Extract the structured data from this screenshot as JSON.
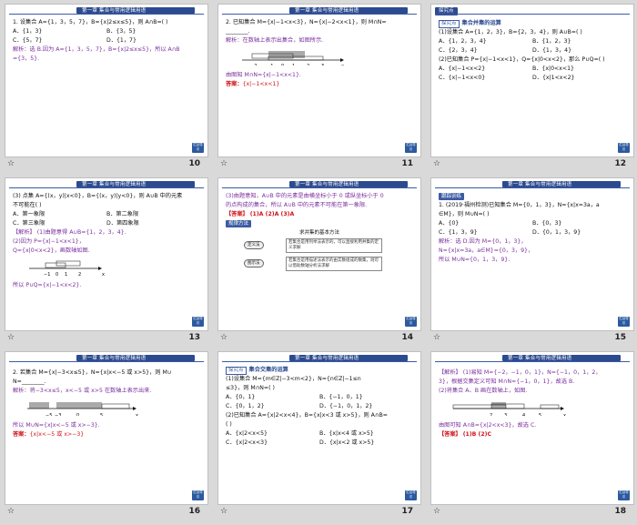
{
  "header_text": "第一章  集合与常用逻辑用语",
  "back_label": "栏目导引",
  "footer_icon": "☆",
  "slides": [
    {
      "num": "10",
      "lines": [
        "1. 设集合 A={1，3，5，7}，B={x|2≤x≤5}，则 A∩B=(      )"
      ],
      "opts": [
        "A．{1，3}",
        "B．{3，5}",
        "C．{5，7}",
        "D．{1，7}"
      ],
      "purple": [
        "解析：选 B.因为 A={1，3，5，7}，B={x|2≤x≤5}，所以 A∩B",
        "={3，5}."
      ]
    },
    {
      "num": "11",
      "lines": [
        "2. 已知集合 M={x|−1<x<3}，N={x|−2<x<1}，则 M∩N=",
        "________."
      ],
      "purple": [
        "解析：在数轴上表示出集合，如图所示."
      ],
      "axis_ticks": [
        "−2",
        "−1",
        "0",
        "1",
        "2",
        "3",
        "x"
      ],
      "purple2": [
        "由图知 M∩N={x|−1<x<1}."
      ],
      "answer_label": "答案：",
      "answer": "{x|−1<x<1}"
    },
    {
      "num": "12",
      "tab": "探究点",
      "tab_title": "集合并集的运算",
      "lines": [
        "(1)设集合 A={1，2，3}，B={2，3，4}，则 A∪B=(      )"
      ],
      "opts": [
        "A．{1，2，3，4}",
        "B．{1，2，3}",
        "C．{2，3，4}",
        "D．{1，3，4}"
      ],
      "lines2": [
        "(2)已知集合 P={x|−1<x<1}，Q={x|0<x<2}，那么 P∪Q=(      )"
      ],
      "opts2": [
        "A．{x|−1<x<2}",
        "B．{x|0<x<1}",
        "C．{x|−1<x<0}",
        "D．{x|1<x<2}"
      ]
    },
    {
      "num": "13",
      "lines": [
        "(3) 点集 A={(x，y)|x<0}，B={(x，y)|y<0}，则 A∪B 中的元素",
        "不可能在(      )"
      ],
      "opts": [
        "A．第一象限",
        "B．第二象限",
        "C．第三象限",
        "D．第四象限"
      ],
      "purple": [
        "【解析】 (1)由题意得 A∪B={1，2，3，4}.",
        "(2)因为 P={x|−1<x<1}，",
        "Q={x|0<x<2}，画数轴如图."
      ],
      "axis_ticks": [
        "−1",
        "0",
        "1",
        "2",
        "x"
      ],
      "purple2": [
        "所以 P∪Q={x|−1<x<2}."
      ]
    },
    {
      "num": "14",
      "purple": [
        "(3)由题意知，A∪B 中的元素是由横坐标小于 0 或纵坐标小于 0",
        "的点构成的集合，所以 A∪B 中的元素不可能在第一象限."
      ],
      "answer_label": "【答案】",
      "answer": "(1)A   (2)A   (3)A",
      "method_tag": "规律方法",
      "diagram_title": "求并集的基本方法",
      "diagram_left": [
        "定义法",
        "图示法"
      ],
      "diagram_right": [
        "若集合是用列举法表示的，可以直接利用并集的定义求解",
        "若集合是用描述法表示的由实数组成的数集，则可以借助数轴分析法求解"
      ]
    },
    {
      "num": "15",
      "tag": "跟踪训练",
      "lines": [
        "1. (2019·福州检测)已知集合 M={0，1，3}，N={x|x=3a，a",
        "∈M}，则 M∪N=(      )"
      ],
      "opts": [
        "A．{0}",
        "B．{0，3}",
        "C．{1，3，9}",
        "D．{0，1，3，9}"
      ],
      "purple": [
        "解析：选 D.因为 M={0，1，3}，",
        "N={x|x=3a，a∈M}={0，3，9}，",
        "所以 M∪N={0，1，3，9}."
      ]
    },
    {
      "num": "16",
      "lines": [
        "2. 若集合 M={x|−3<x≤5}，N={x|x<−5 或 x>5}，则 M∪",
        "N=________."
      ],
      "purple": [
        "解析：将−3<x≤5，x<−5 或 x>5 在数轴上表示出来."
      ],
      "axis_ticks": [
        "−5",
        "−3",
        "0",
        "5",
        "x"
      ],
      "purple2": [
        "所以 M∪N={x|x<−5 或 x>−3}."
      ],
      "answer_label": "答案：",
      "answer": "{x|x<−5 或 x>−3}"
    },
    {
      "num": "17",
      "tab": "探究点",
      "tab_title": "集合交集的运算",
      "lines": [
        "(1)设集合 M={m∈Z|−3<m<2}，N={n∈Z|−1≤n",
        "≤3}，则 M∩N=(      )"
      ],
      "opts": [
        "A．{0，1}",
        "B．{−1，0，1}",
        "C．{0，1，2}",
        "D．{−1，0，1，2}"
      ],
      "lines2": [
        "(2)已知集合 A={x|2<x<4}，B={x|x<3 或 x>5}，则 A∩B=",
        "(      )"
      ],
      "opts2": [
        "A．{x|2<x<5}",
        "B．{x|x<4 或 x>5}",
        "C．{x|2<x<3}",
        "D．{x|x<2 或 x>5}"
      ]
    },
    {
      "num": "18",
      "purple": [
        "【解析】 (1)易知 M={−2，−1，0，1}，N={−1，0，1，2，",
        "3}，根据交集定义可知 M∩N={−1，0，1}，故选 B.",
        "(2)将集合 A、B 画在数轴上，如图."
      ],
      "axis_ticks": [
        "2",
        "3",
        "4",
        "5",
        "x"
      ],
      "purple2": [
        "由图可知 A∩B={x|2<x<3}，故选 C."
      ],
      "answer_label": "【答案】",
      "answer": "(1)B   (2)C"
    }
  ]
}
